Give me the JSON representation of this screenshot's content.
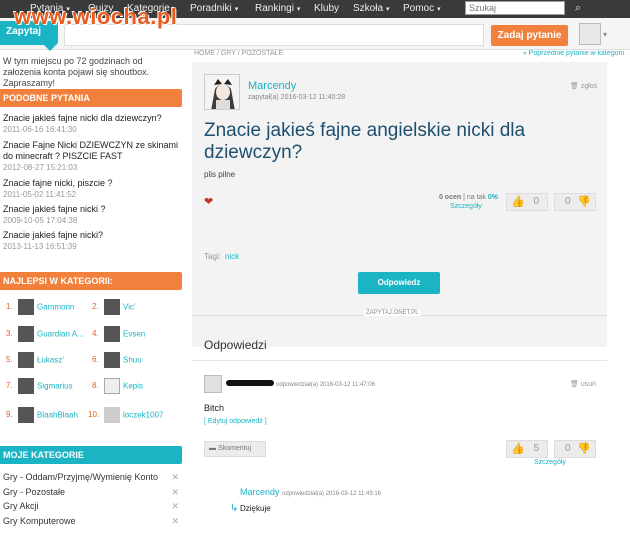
{
  "watermark": "www.wiocha.pl",
  "topnav": {
    "items": [
      {
        "label": "Pytania",
        "caret": "▾"
      },
      {
        "label": "Quizy",
        "caret": ""
      },
      {
        "label": "Kategorie",
        "caret": "▾"
      },
      {
        "label": "Poradniki",
        "caret": "▾"
      },
      {
        "label": "Rankingi",
        "caret": "▾"
      },
      {
        "label": "Kluby",
        "caret": ""
      },
      {
        "label": "Szkoła",
        "caret": "▾"
      },
      {
        "label": "Pomoc",
        "caret": "▾"
      }
    ],
    "search_placeholder": "Szukaj"
  },
  "header": {
    "logo": "Zapytaj",
    "ask_button": "Zadaj pytanie"
  },
  "sidebar": {
    "shoutbox": "W tym miejscu po 72 godzinach od założenia konta pojawi się shoutbox. Zapraszamy!",
    "similar_title": "PODOBNE PYTANIA",
    "similar": [
      {
        "q": "Znacie jakieś fajne nicki dla dziewczyn?",
        "d": "2011-06-16 16:41:30"
      },
      {
        "q": "Znacie Fajne Nicki DZIEWCZYN ze skinami do minecraft ? PISZCIE FAST",
        "d": "2012-08-27 15:21:03"
      },
      {
        "q": "Znacie fajne nicki, piszcie ?",
        "d": "2011-05-02 11:41:52"
      },
      {
        "q": "Znacie jakieś fajne nicki ?",
        "d": "2009-10-05 17:04:38"
      },
      {
        "q": "Znacie jakieś fajne nicki?",
        "d": "2013-11-13 16:51:39"
      }
    ],
    "best_title": "NAJLEPSI W KATEGORII:",
    "best": [
      {
        "n": "1.",
        "name": "Gammorin"
      },
      {
        "n": "2.",
        "name": "Vic'"
      },
      {
        "n": "3.",
        "name": "Guardian A..."
      },
      {
        "n": "4.",
        "name": "Evsen"
      },
      {
        "n": "5.",
        "name": "Łukasz'"
      },
      {
        "n": "6.",
        "name": "Shuu"
      },
      {
        "n": "7.",
        "name": "Sigmarius"
      },
      {
        "n": "8.",
        "name": "Kepis"
      },
      {
        "n": "9.",
        "name": "BlaahBlaah"
      },
      {
        "n": "10.",
        "name": "loczek1007"
      }
    ],
    "cats_title": "MOJE KATEGORIE",
    "cats": [
      "Gry - Oddam/Przyjmę/Wymienię Konto",
      "Gry - Pozostałe",
      "Gry Akcji",
      "Gry Komputerowe"
    ]
  },
  "breadcrumb": {
    "left": "HOME / GRY / POZOSTAŁE",
    "right": "« Poprzednie pytanie w kategorii"
  },
  "question": {
    "author": "Marcendy",
    "date": "zapytał(a) 2016-03-12 11:40:28",
    "report": "zgłoś",
    "title": "Znacie jakieś fajne angielskie nicki dla dziewczyn?",
    "body": "plis pilne",
    "rating_a": "0 ocen",
    "rating_b": " | na tak ",
    "rating_c": "0%",
    "details": "Szczegóły",
    "up": "0",
    "down": "0",
    "tags_label": "Tagi:",
    "tag": "nick",
    "answer_button": "Odpowiedz"
  },
  "answers": {
    "separator": "ZAPYTAJ.ONET.PL",
    "title": "Odpowiedzi",
    "date": "odpowiedział(a) 2016-03-12 11:47:06",
    "delete": "usuń",
    "body": "Bitch",
    "edit": "[ Edytuj odpowiedź ]",
    "comment_button": "Skomentuj",
    "up": "5",
    "down": "0",
    "details": "Szczegóły",
    "comment_author": "Marcendy",
    "comment_date": "odpowiedział(a) 2016-03-12 11:49:16",
    "comment_body": "Dziękuje"
  }
}
